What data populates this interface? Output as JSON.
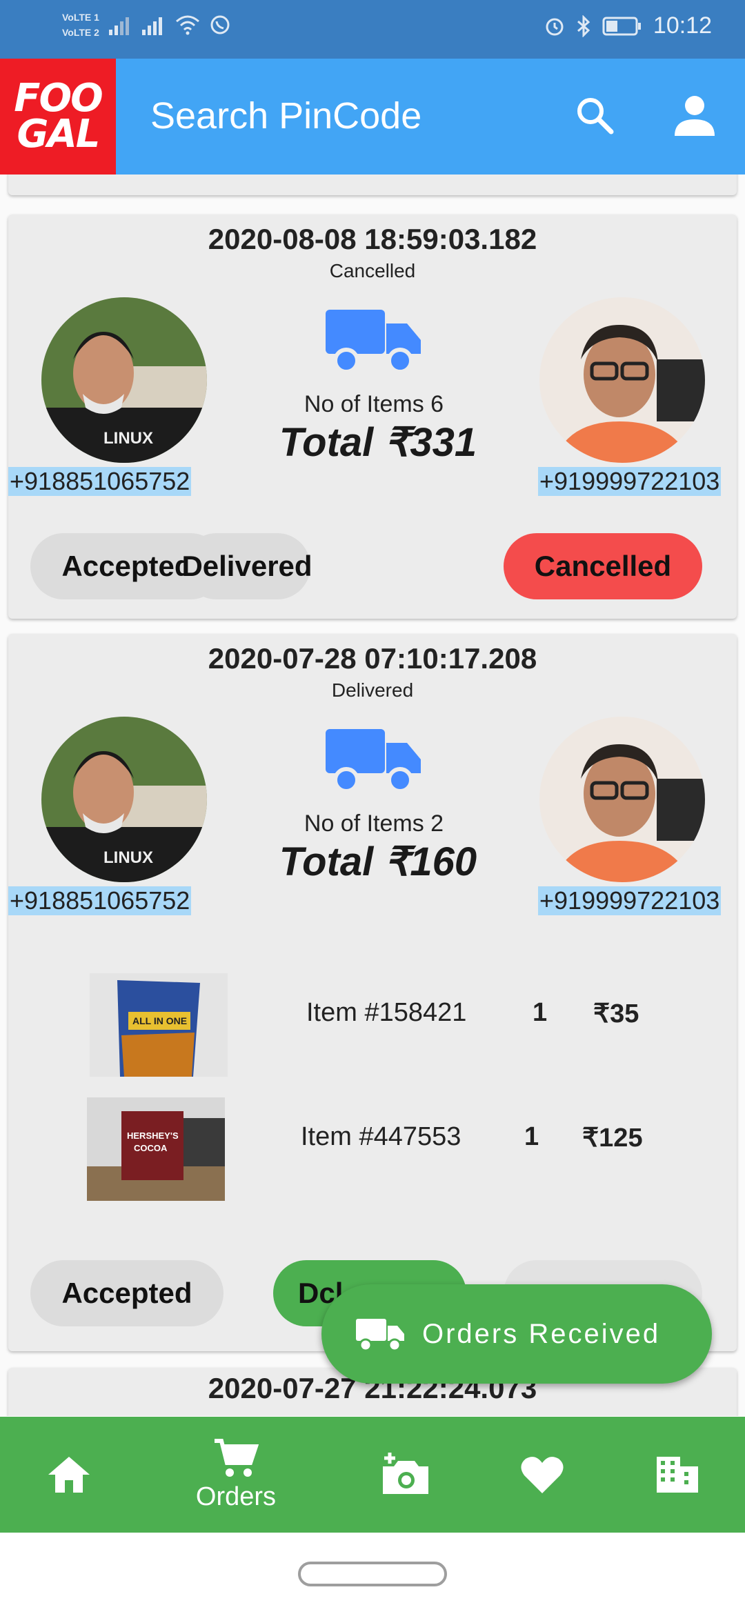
{
  "status_bar": {
    "volte_1": "VoLTE 1",
    "volte_2": "VoLTE 2",
    "time": "10:12",
    "icons": [
      "signal-icon",
      "signal-icon",
      "wifi-icon",
      "whatsapp-icon",
      "alarm-icon",
      "bluetooth-icon",
      "battery-icon"
    ]
  },
  "app_bar": {
    "logo_line1": "FOO",
    "logo_line2": "GAL",
    "title": "Search  PinCode",
    "icons": [
      "search-icon",
      "person-icon"
    ],
    "logo_color": "#ee1c25",
    "bar_color": "#42a5f5"
  },
  "orders": [
    {
      "datetime": "2020-08-08 18:59:03.182",
      "status": "Cancelled",
      "left_phone": "+918851065752",
      "right_phone": "+919999722103",
      "items_count": "No of Items 6",
      "total": "Total ₹331",
      "buttons": [
        "Accepted",
        "Delivered",
        "Cancelled"
      ],
      "active_button": "Cancelled"
    },
    {
      "datetime": "2020-07-28 07:10:17.208",
      "status": "Delivered",
      "left_phone": "+918851065752",
      "right_phone": "+919999722103",
      "items_count": "No of Items 2",
      "total": "Total ₹160",
      "items": [
        {
          "label": "Item #158421",
          "qty": "1",
          "price": "₹35"
        },
        {
          "label": "Item #447553",
          "qty": "1",
          "price": "₹125"
        }
      ],
      "buttons": [
        "Accepted",
        "Dcl"
      ],
      "active_button": "Delivered"
    },
    {
      "datetime": "2020-07-27 21:22:24.073"
    }
  ],
  "fab": {
    "label": "Orders Received",
    "icon": "truck-icon"
  },
  "bottom_nav": {
    "items": [
      {
        "icon": "home-icon",
        "label": ""
      },
      {
        "icon": "cart-icon",
        "label": "Orders"
      },
      {
        "icon": "add-photo-icon",
        "label": ""
      },
      {
        "icon": "heart-icon",
        "label": ""
      },
      {
        "icon": "building-icon",
        "label": ""
      }
    ],
    "color": "#4caf50"
  },
  "colors": {
    "accent_blue": "#42a5f5",
    "cancel_red": "#f44c4c",
    "deliver_green": "#4caf50",
    "truck_blue": "#448aff"
  }
}
